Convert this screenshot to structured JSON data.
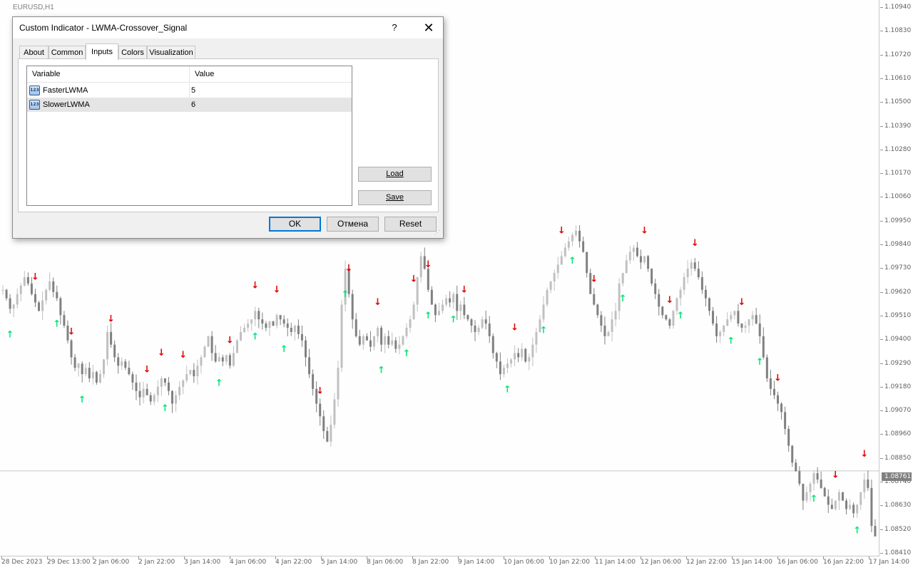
{
  "chart": {
    "symbol": "EURUSD,H1",
    "current_price": "1.08761",
    "price_ticks": [
      "1.10940",
      "1.10830",
      "1.10720",
      "1.10610",
      "1.10500",
      "1.10390",
      "1.10280",
      "1.10170",
      "1.10060",
      "1.09950",
      "1.09840",
      "1.09730",
      "1.09620",
      "1.09510",
      "1.09400",
      "1.09290",
      "1.09180",
      "1.09070",
      "1.08960",
      "1.08850",
      "1.08740",
      "1.08630",
      "1.08520",
      "1.08410"
    ],
    "time_ticks": [
      "28 Dec 2023",
      "29 Dec 13:00",
      "2 Jan 06:00",
      "2 Jan 22:00",
      "3 Jan 14:00",
      "4 Jan 06:00",
      "4 Jan 22:00",
      "5 Jan 14:00",
      "8 Jan 06:00",
      "8 Jan 22:00",
      "9 Jan 14:00",
      "10 Jan 06:00",
      "10 Jan 22:00",
      "11 Jan 14:00",
      "12 Jan 06:00",
      "12 Jan 22:00",
      "15 Jan 14:00",
      "16 Jan 06:00",
      "16 Jan 22:00",
      "17 Jan 14:00"
    ],
    "colors": {
      "bull": "#c0c0c0",
      "bear": "#808080",
      "up_arrow": "#00e676",
      "down_arrow": "#e00000",
      "grid_line": "#c8c8c8"
    },
    "price_series": [
      1.0962,
      1.0958,
      1.0953,
      1.0955,
      1.096,
      1.0964,
      1.0968,
      1.0965,
      1.096,
      1.0956,
      1.0952,
      1.0957,
      1.0962,
      1.0966,
      1.0961,
      1.0958,
      1.095,
      1.0945,
      1.0938,
      1.093,
      1.0925,
      1.0927,
      1.0922,
      1.0925,
      1.092,
      1.0923,
      1.0918,
      1.0922,
      1.0929,
      1.0942,
      1.0936,
      1.093,
      1.0926,
      1.0928,
      1.0925,
      1.0922,
      1.0918,
      1.0914,
      1.0911,
      1.0915,
      1.0912,
      1.0909,
      1.0912,
      1.0916,
      1.092,
      1.0918,
      1.0914,
      1.0908,
      1.0912,
      1.0916,
      1.0919,
      1.0922,
      1.0924,
      1.0921,
      1.0926,
      1.093,
      1.0935,
      1.094,
      1.0932,
      1.0928,
      1.093,
      1.0928,
      1.0931,
      1.0926,
      1.0932,
      1.0938,
      1.0942,
      1.0944,
      1.0946,
      1.0948,
      1.0952,
      1.0948,
      1.0946,
      1.0944,
      1.0947,
      1.0945,
      1.095,
      1.0948,
      1.0946,
      1.0944,
      1.0942,
      1.0945,
      1.0941,
      1.0938,
      1.093,
      1.0922,
      1.0915,
      1.0908,
      1.0902,
      1.0895,
      1.089,
      1.0898,
      1.091,
      1.0925,
      1.0955,
      1.0972,
      1.096,
      1.0948,
      1.094,
      1.0936,
      1.094,
      1.0938,
      1.0935,
      1.094,
      1.0944,
      1.0936,
      1.094,
      1.0936,
      1.0938,
      1.0934,
      1.0936,
      1.094,
      1.0944,
      1.0948,
      1.0955,
      1.0968,
      1.0978,
      1.0972,
      1.0962,
      1.0955,
      1.095,
      1.0952,
      1.0955,
      1.0958,
      1.0956,
      1.096,
      1.0952,
      1.0955,
      1.095,
      1.0948,
      1.0945,
      1.0942,
      1.0944,
      1.0948,
      1.0946,
      1.094,
      1.0932,
      1.0928,
      1.0922,
      1.0925,
      1.0927,
      1.0929,
      1.0932,
      1.093,
      1.0934,
      1.0928,
      1.093,
      1.0936,
      1.0942,
      1.0948,
      1.0955,
      1.0962,
      1.0966,
      1.097,
      1.0974,
      1.0978,
      1.0982,
      1.0985,
      1.0988,
      1.099,
      1.0985,
      1.098,
      1.097,
      1.096,
      1.0955,
      1.095,
      1.0945,
      1.094,
      1.0942,
      1.0948,
      1.0952,
      1.0965,
      1.097,
      1.0976,
      1.098,
      1.0982,
      1.0978,
      1.0975,
      1.0978,
      1.0972,
      1.0965,
      1.096,
      1.0954,
      1.095,
      1.0948,
      1.0945,
      1.0952,
      1.0958,
      1.0962,
      1.0968,
      1.0972,
      1.0975,
      1.0972,
      1.0968,
      1.0962,
      1.0958,
      1.0952,
      1.0946,
      1.094,
      1.0942,
      1.0945,
      1.0948,
      1.095,
      1.0952,
      1.0946,
      1.0944,
      1.0945,
      1.0948,
      1.095,
      1.0946,
      1.094,
      1.093,
      1.092,
      1.0915,
      1.0912,
      1.0908,
      1.0904,
      1.0896,
      1.0888,
      1.088,
      1.0876,
      1.087,
      1.0862,
      1.0866,
      1.087,
      1.0875,
      1.0872,
      1.0868,
      1.0864,
      1.086,
      1.0858,
      1.0862,
      1.0866,
      1.0862,
      1.0858,
      1.086,
      1.0856,
      1.086,
      1.0866,
      1.0872,
      1.0868,
      1.085,
      1.0845
    ],
    "up_arrow_indices": [
      2,
      15,
      22,
      45,
      60,
      70,
      78,
      95,
      105,
      112,
      118,
      125,
      140,
      150,
      158,
      172,
      188,
      202,
      210,
      225,
      237
    ],
    "down_arrow_indices": [
      9,
      19,
      30,
      40,
      44,
      50,
      63,
      70,
      76,
      88,
      96,
      104,
      114,
      118,
      128,
      142,
      155,
      164,
      178,
      185,
      192,
      205,
      215,
      231,
      239
    ]
  },
  "dialog": {
    "title": "Custom Indicator - LWMA-Crossover_Signal",
    "help": "?",
    "close": "✕",
    "tabs": [
      "About",
      "Common",
      "Inputs",
      "Colors",
      "Visualization"
    ],
    "active_tab": "Inputs",
    "table": {
      "headers": [
        "Variable",
        "Value"
      ],
      "rows": [
        {
          "icon": "123",
          "name": "FasterLWMA",
          "value": "5"
        },
        {
          "icon": "123",
          "name": "SlowerLWMA",
          "value": "6"
        }
      ]
    },
    "load_label": "Load",
    "save_label": "Save",
    "ok_label": "OK",
    "cancel_label": "Отмена",
    "reset_label": "Reset"
  }
}
